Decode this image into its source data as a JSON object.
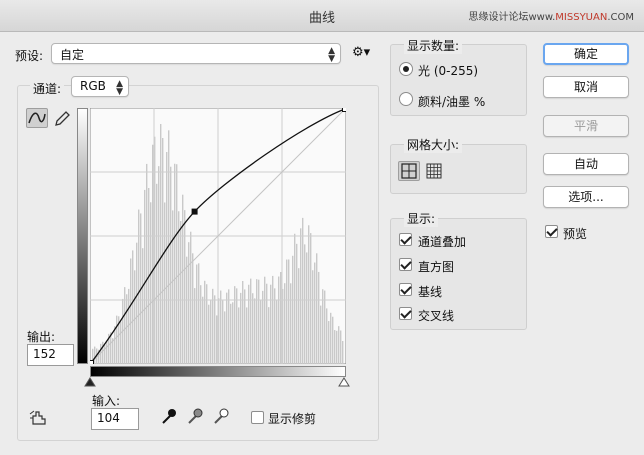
{
  "window": {
    "title": "曲线"
  },
  "watermark": {
    "text1": "思缘设计论坛",
    "text2": "www.",
    "text3": "MISSYUAN",
    "text4": ".COM"
  },
  "preset": {
    "label": "预设:",
    "value": "自定"
  },
  "channel": {
    "label": "通道:",
    "value": "RGB"
  },
  "output": {
    "label": "输出:",
    "value": "152"
  },
  "input": {
    "label": "输入:",
    "value": "104"
  },
  "show_clipping": {
    "label": "显示修剪",
    "checked": false
  },
  "show_amount": {
    "title": "显示数量:",
    "options": [
      {
        "label": "光 (0-255)",
        "selected": true
      },
      {
        "label": "颜料/油墨 %",
        "selected": false
      }
    ]
  },
  "grid_size": {
    "title": "网格大小:"
  },
  "display": {
    "title": "显示:",
    "options": [
      {
        "label": "通道叠加",
        "checked": true
      },
      {
        "label": "直方图",
        "checked": true
      },
      {
        "label": "基线",
        "checked": true
      },
      {
        "label": "交叉线",
        "checked": true
      }
    ]
  },
  "buttons": {
    "ok": "确定",
    "cancel": "取消",
    "smooth": "平滑",
    "auto": "自动",
    "options": "选项..."
  },
  "preview": {
    "label": "预览",
    "checked": true
  },
  "curve": {
    "point_input": 104,
    "point_output": 152,
    "min": 0,
    "max": 255
  }
}
